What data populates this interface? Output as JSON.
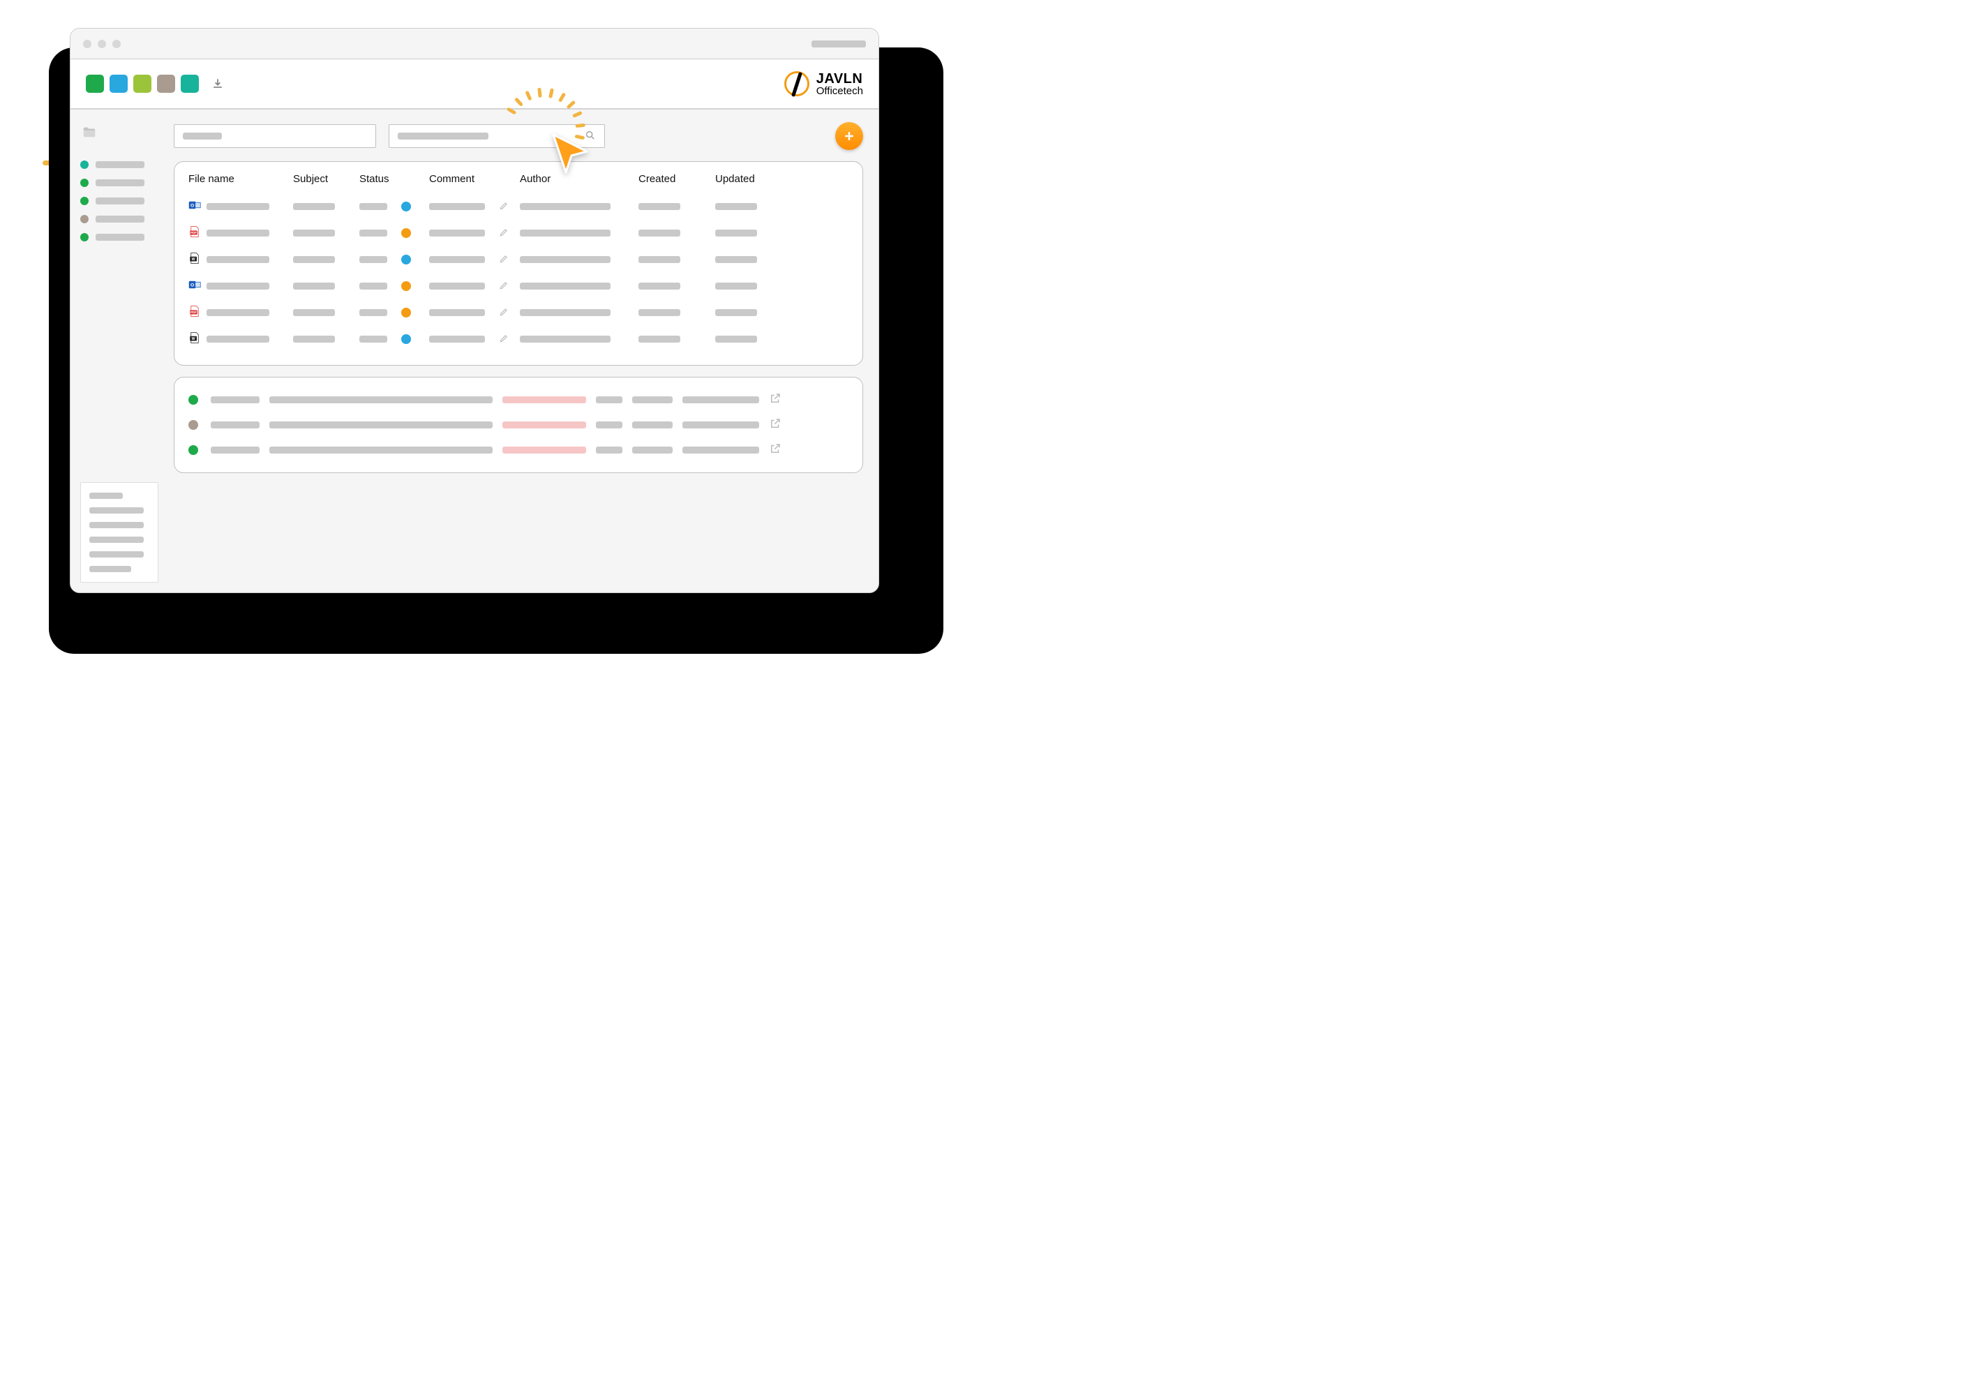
{
  "brand": {
    "line1": "JAVLN",
    "line2": "Officetech"
  },
  "toolbar_swatches": [
    "#1eaa4b",
    "#29a7df",
    "#9cc43a",
    "#a99b8f",
    "#18b39b"
  ],
  "sidebar": {
    "items": [
      {
        "color": "#18b39b"
      },
      {
        "color": "#1eaa4b"
      },
      {
        "color": "#1eaa4b"
      },
      {
        "color": "#a99b8f"
      },
      {
        "color": "#1eaa4b"
      }
    ]
  },
  "table": {
    "headers": {
      "file_name": "File name",
      "subject": "Subject",
      "status": "Status",
      "comment": "Comment",
      "author": "Author",
      "created": "Created",
      "updated": "Updated"
    },
    "rows": [
      {
        "type": "outlook",
        "status_color": "#29a7df"
      },
      {
        "type": "pdf",
        "status_color": "#f39c12"
      },
      {
        "type": "word",
        "status_color": "#29a7df"
      },
      {
        "type": "outlook",
        "status_color": "#f39c12"
      },
      {
        "type": "pdf",
        "status_color": "#f39c12"
      },
      {
        "type": "word",
        "status_color": "#29a7df"
      }
    ]
  },
  "bottom_rows": [
    {
      "color": "#1eaa4b"
    },
    {
      "color": "#a99b8f"
    },
    {
      "color": "#1eaa4b"
    }
  ]
}
